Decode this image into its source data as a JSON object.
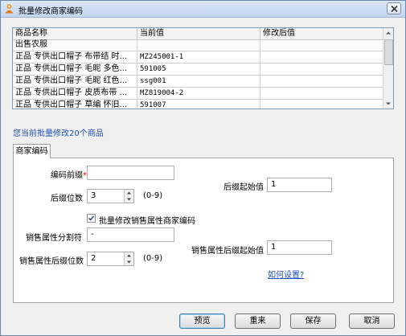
{
  "window": {
    "title": "批量修改商家编码"
  },
  "table": {
    "columns": [
      "商品名称",
      "当前值",
      "修改后值"
    ],
    "rows": [
      [
        "出售农服",
        "",
        ""
      ],
      [
        "正品 专供出口帽子 布带结 时...",
        "MZ245001-1",
        ""
      ],
      [
        "正品 专供出口帽子 毛昵 多色...",
        "591005",
        ""
      ],
      [
        "正品 专供出口帽子 毛昵 红色...",
        "ssg001",
        ""
      ],
      [
        "正品 专供出口帽子 皮质布带 ...",
        "MZ819004-2",
        ""
      ],
      [
        "正品 专供出口帽子 草编 怀旧...",
        "591007",
        ""
      ]
    ]
  },
  "info_text": "您当前批量修改20个商品",
  "tab_label": "商家编码",
  "form": {
    "prefix_label": "编码前缀",
    "required_mark": "*",
    "prefix_value": "",
    "suffix_digits_label": "后缀位数",
    "suffix_digits_value": "3",
    "range_hint_1": "(0-9)",
    "suffix_start_label": "后缀起始值",
    "suffix_start_value": "1",
    "batch_sales_attr_label": "批量修改销售属性商家编码",
    "batch_sales_attr_checked": true,
    "separator_label": "销售属性分割符",
    "separator_value": "-",
    "sales_suffix_start_label": "销售属性后缀起始值",
    "sales_suffix_start_value": "1",
    "sales_suffix_digits_label": "销售属性后缀位数",
    "sales_suffix_digits_value": "2",
    "range_hint_2": "(0-9)",
    "how_to_link": "如何设置?"
  },
  "buttons": {
    "preview": "预览",
    "reset": "重来",
    "save": "保存",
    "cancel": "取消"
  },
  "colors": {
    "accent_link": "#1f4fb8",
    "required": "#e00000",
    "title_bar": "#c3d6ee"
  }
}
